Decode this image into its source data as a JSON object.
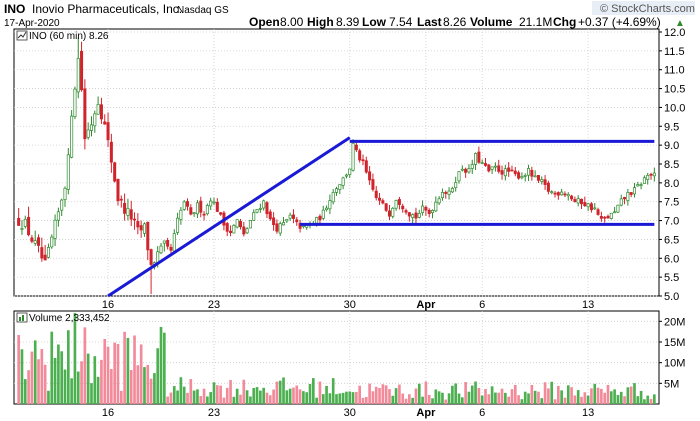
{
  "header": {
    "symbol": "INO",
    "company": "Inovio Pharmaceuticals, Inc.",
    "exchange": "Nasdaq GS",
    "date": "17-Apr-2020",
    "watermark": "© StockCharts.com",
    "open_label": "Open",
    "open_value": "8.00",
    "high_label": "High",
    "high_value": "8.39",
    "low_label": "Low",
    "low_value": "7.54",
    "last_label": "Last",
    "last_value": "8.26",
    "volume_label": "Volume",
    "volume_value": "21.1M",
    "chg_label": "Chg",
    "chg_value": "+0.37 (+4.69%)",
    "chg_arrow": "▲"
  },
  "price_panel": {
    "legend": "INO (60 min) 8.26",
    "legend_icon": "chart-legend-icon"
  },
  "volume_panel": {
    "legend": "Volume 2,333,452",
    "legend_icon": "volume-legend-icon"
  },
  "colors": {
    "up": "#2e8b2e",
    "down": "#d0242c",
    "vol_up": "#4caf50",
    "vol_down": "#f28a9a",
    "trendline": "#1a1ad6",
    "grid": "#cccccc",
    "watermark_bg": "#e8eef6"
  },
  "chart_data": [
    {
      "type": "candlestick",
      "title": "INO (60 min) 8.26",
      "timeframe": "60 min",
      "x_labels": [
        "16",
        "23",
        "30",
        "Apr",
        "6",
        "13"
      ],
      "y_ticks": [
        "5.0",
        "5.5",
        "6.0",
        "6.5",
        "7.0",
        "7.5",
        "8.0",
        "8.5",
        "9.0",
        "9.5",
        "10.0",
        "10.5",
        "11.0",
        "11.5",
        "12.0"
      ],
      "ylim": [
        5.0,
        12.0
      ],
      "grid": true,
      "legend_position": "top-left",
      "close_path": [
        [
          0,
          7.0
        ],
        [
          2,
          6.9
        ],
        [
          4,
          6.5
        ],
        [
          6,
          6.2
        ],
        [
          8,
          5.8
        ],
        [
          10,
          6.5
        ],
        [
          12,
          7.2
        ],
        [
          14,
          8.0
        ],
        [
          15,
          8.6
        ],
        [
          16,
          9.9
        ],
        [
          17,
          10.6
        ],
        [
          18,
          11.5
        ],
        [
          19,
          10.5
        ],
        [
          20,
          9.2
        ],
        [
          22,
          9.6
        ],
        [
          24,
          10.2
        ],
        [
          26,
          9.5
        ],
        [
          28,
          8.6
        ],
        [
          30,
          7.6
        ],
        [
          32,
          7.3
        ],
        [
          34,
          7.1
        ],
        [
          36,
          6.7
        ],
        [
          38,
          6.8
        ],
        [
          40,
          5.8
        ],
        [
          42,
          6.1
        ],
        [
          44,
          6.3
        ],
        [
          46,
          6.2
        ],
        [
          48,
          7.0
        ],
        [
          50,
          7.5
        ],
        [
          52,
          7.1
        ],
        [
          54,
          7.4
        ],
        [
          56,
          7.2
        ],
        [
          58,
          7.6
        ],
        [
          60,
          7.3
        ],
        [
          62,
          6.9
        ],
        [
          64,
          6.7
        ],
        [
          66,
          7.0
        ],
        [
          68,
          6.6
        ],
        [
          70,
          7.0
        ],
        [
          72,
          7.3
        ],
        [
          74,
          7.5
        ],
        [
          76,
          7.0
        ],
        [
          78,
          6.8
        ],
        [
          80,
          6.9
        ],
        [
          82,
          7.1
        ],
        [
          84,
          6.9
        ],
        [
          86,
          6.8
        ],
        [
          88,
          6.9
        ],
        [
          90,
          7.0
        ],
        [
          92,
          7.2
        ],
        [
          94,
          7.6
        ],
        [
          96,
          7.9
        ],
        [
          98,
          8.1
        ],
        [
          100,
          8.4
        ],
        [
          101,
          9.0
        ],
        [
          102,
          8.8
        ],
        [
          104,
          8.5
        ],
        [
          106,
          8.0
        ],
        [
          108,
          7.6
        ],
        [
          110,
          7.4
        ],
        [
          112,
          7.2
        ],
        [
          114,
          7.6
        ],
        [
          116,
          7.4
        ],
        [
          118,
          7.2
        ],
        [
          120,
          7.1
        ],
        [
          122,
          7.3
        ],
        [
          124,
          7.2
        ],
        [
          126,
          7.5
        ],
        [
          128,
          7.8
        ],
        [
          130,
          7.7
        ],
        [
          132,
          8.1
        ],
        [
          134,
          8.4
        ],
        [
          136,
          8.3
        ],
        [
          138,
          8.7
        ],
        [
          140,
          8.5
        ],
        [
          142,
          8.3
        ],
        [
          144,
          8.4
        ],
        [
          146,
          8.3
        ],
        [
          148,
          8.3
        ],
        [
          150,
          8.2
        ],
        [
          152,
          8.2
        ],
        [
          154,
          8.3
        ],
        [
          156,
          8.1
        ],
        [
          158,
          8.0
        ],
        [
          160,
          7.8
        ],
        [
          162,
          7.7
        ],
        [
          164,
          7.8
        ],
        [
          166,
          7.7
        ],
        [
          168,
          7.5
        ],
        [
          170,
          7.5
        ],
        [
          172,
          7.4
        ],
        [
          174,
          7.3
        ],
        [
          176,
          7.0
        ],
        [
          178,
          7.1
        ],
        [
          180,
          7.2
        ],
        [
          182,
          7.5
        ],
        [
          184,
          7.7
        ],
        [
          186,
          7.8
        ],
        [
          188,
          8.0
        ],
        [
          190,
          8.2
        ],
        [
          192,
          8.26
        ]
      ],
      "n_bars": 193,
      "lines": [
        {
          "name": "trendline",
          "from": [
            27,
            5.0
          ],
          "to": [
            100,
            9.2
          ]
        },
        {
          "name": "resistance",
          "from": [
            100,
            9.1
          ],
          "to": [
            192,
            9.1
          ]
        },
        {
          "name": "support",
          "from": [
            85,
            6.9
          ],
          "to": [
            192,
            6.9
          ]
        }
      ]
    },
    {
      "type": "bar",
      "title": "Volume 2,333,452",
      "y_ticks": [
        "5M",
        "10M",
        "15M",
        "20M"
      ],
      "ylim": [
        0,
        22500000
      ],
      "x_labels": [
        "16",
        "23",
        "30",
        "Apr",
        "6",
        "13"
      ],
      "grid": true,
      "legend_position": "top-left"
    }
  ]
}
